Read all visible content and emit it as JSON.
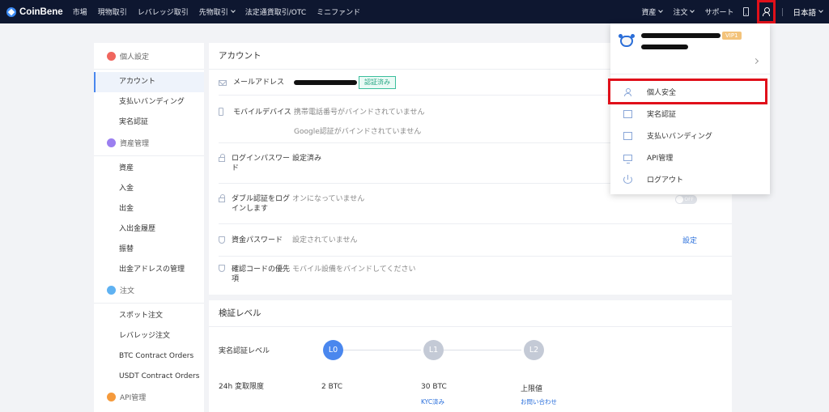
{
  "topbar": {
    "brand": "CoinBene",
    "nav": [
      "市場",
      "現物取引",
      "レバレッジ取引",
      "先物取引",
      "法定通貨取引/OTC",
      "ミニファンド"
    ],
    "right": {
      "assets": "資産",
      "orders": "注文",
      "support": "サポート",
      "language": "日本語"
    }
  },
  "sidebar": {
    "groups": [
      {
        "label": "個人設定",
        "color": "#f0665e",
        "items": [
          "アカウント",
          "支払いバンディング",
          "実名認証"
        ]
      },
      {
        "label": "資産管理",
        "color": "#9b7ff0",
        "items": [
          "資産",
          "入金",
          "出金",
          "入出金履歴",
          "振替",
          "出金アドレスの管理"
        ]
      },
      {
        "label": "注文",
        "color": "#5fb2f2",
        "items": [
          "スポット注文",
          "レバレッジ注文",
          "BTC Contract Orders",
          "USDT Contract Orders"
        ]
      },
      {
        "label": "API管理",
        "color": "#f59a3c",
        "items": []
      }
    ],
    "active": "アカウント"
  },
  "account": {
    "title": "アカウント",
    "email_label": "メールアドレス",
    "email_badge": "認証済み",
    "mobile_label": "モバイルデバイス",
    "mobile_value1": "携帯電話番号がバインドされていません",
    "mobile_value2": "Google認証がバインドされていません",
    "pwd_label": "ログインパスワード",
    "pwd_value": "設定済み",
    "twofa_label": "ダブル認証をログインします",
    "twofa_value": "オンになっていません",
    "twofa_toggle": "OFF",
    "fund_label": "資金パスワード",
    "fund_value": "設定されていません",
    "fund_link": "設定",
    "code_label": "確認コードの優先項",
    "code_value": "モバイル設備をバインドしてください"
  },
  "verify": {
    "title": "検証レベル",
    "level_label": "実名認証レベル",
    "levels": [
      "L0",
      "L1",
      "L2"
    ],
    "limit_label": "24h 変取限度",
    "limits": [
      "2 BTC",
      "30 BTC",
      "上限値"
    ],
    "l1_note": "KYC済み",
    "l2_note": "お問い合わせ",
    "colors": {
      "active": "#4a87ee",
      "inactive": "#c4cad6"
    }
  },
  "dropdown": {
    "vip": "VIP1",
    "items": [
      "個人安全",
      "実名認証",
      "支払いバンディング",
      "API管理",
      "ログアウト"
    ]
  }
}
